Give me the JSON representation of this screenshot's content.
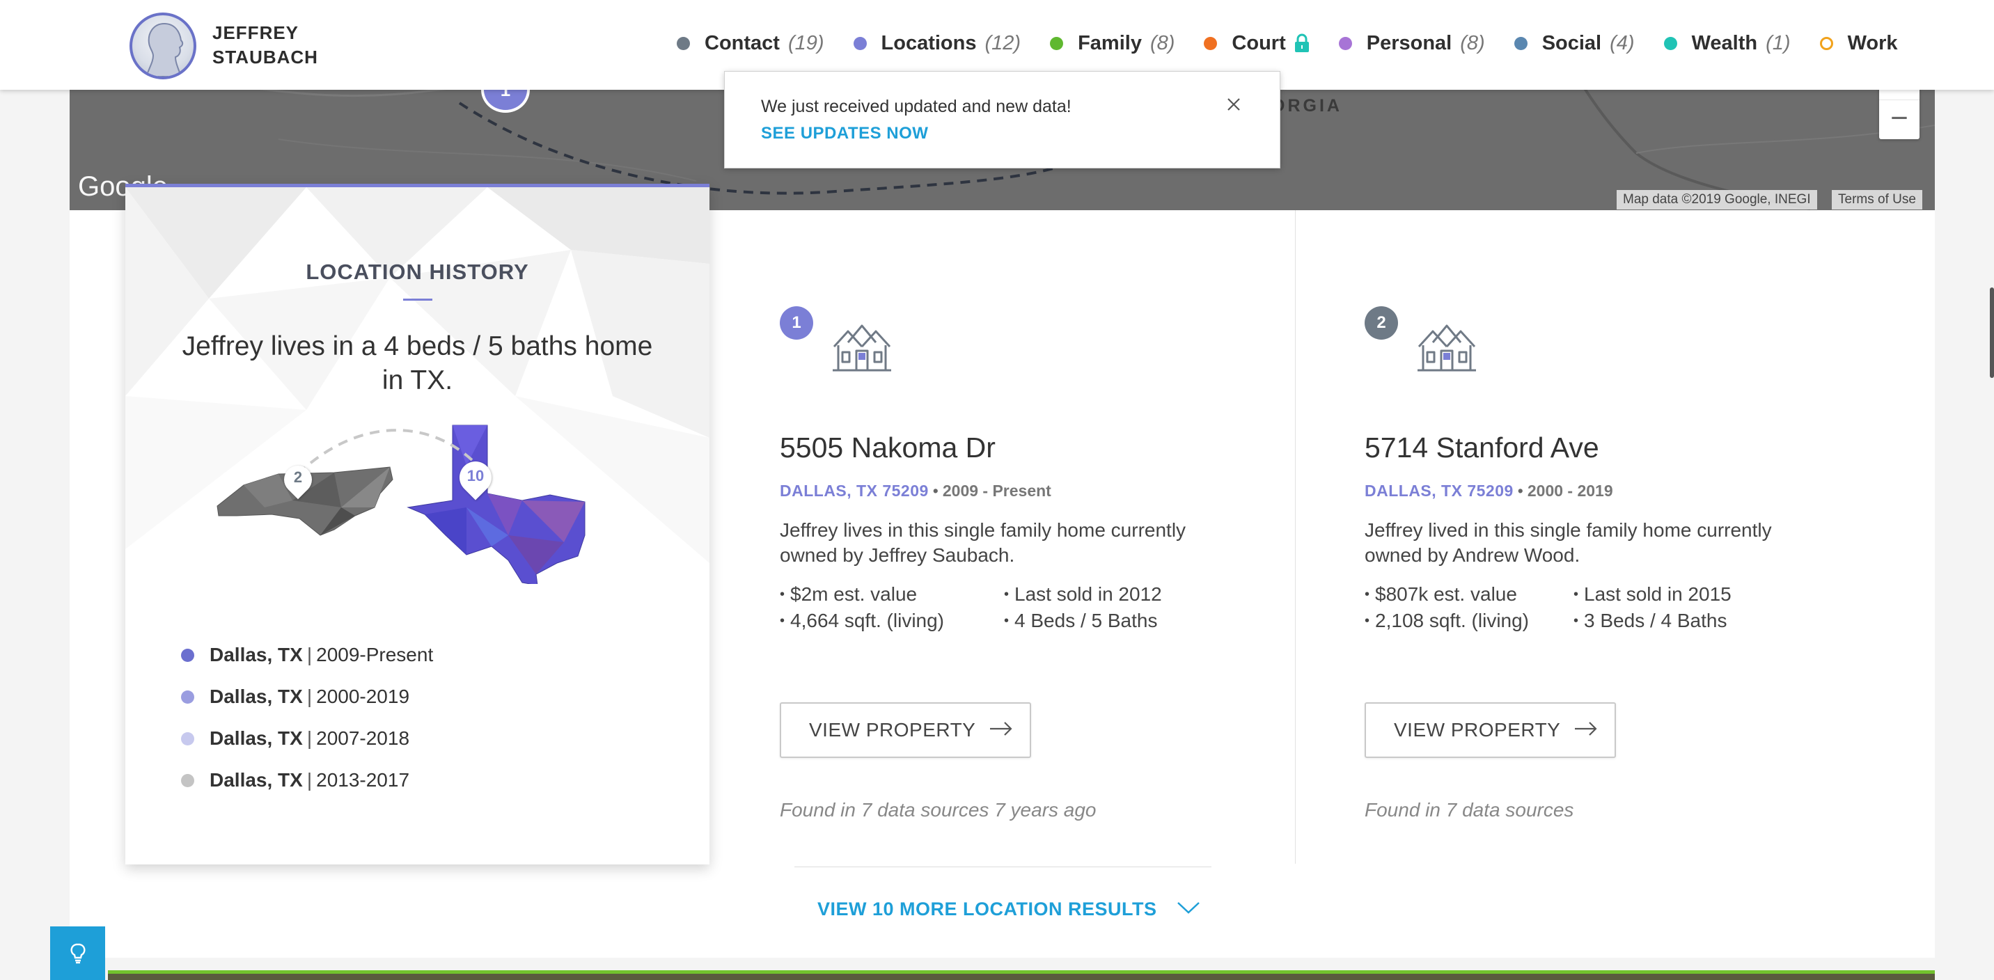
{
  "header": {
    "name_line1": "JEFFREY",
    "name_line2": "STAUBACH",
    "nav": [
      {
        "label": "Contact",
        "count": "(19)",
        "color": "#6e7a86"
      },
      {
        "label": "Locations",
        "count": "(12)",
        "color": "#7b7fd6"
      },
      {
        "label": "Family",
        "count": "(8)",
        "color": "#5fb82f"
      },
      {
        "label": "Court",
        "count": "",
        "color": "#f07021",
        "icon": "lock-icon"
      },
      {
        "label": "Personal",
        "count": "(8)",
        "color": "#a774d6"
      },
      {
        "label": "Social",
        "count": "(4)",
        "color": "#5a87b0"
      },
      {
        "label": "Wealth",
        "count": "(1)",
        "color": "#20c3b5"
      },
      {
        "label": "Work",
        "count": "",
        "color": "#f1a21c",
        "hollow": true
      }
    ]
  },
  "map": {
    "region_label": "ORGIA",
    "logo": "Google",
    "attribution": "Map data ©2019 Google, INEGI",
    "terms": "Terms of Use",
    "zoom_in": "+",
    "zoom_out": "−",
    "pin_number": "1"
  },
  "toast": {
    "message": "We just received updated and new data!",
    "link": "SEE UPDATES NOW"
  },
  "history": {
    "title": "LOCATION HISTORY",
    "summary": "Jeffrey lives in a 4 beds / 5 baths home in TX.",
    "state_pins": [
      "2",
      "10"
    ],
    "locations": [
      {
        "city": "Dallas, TX",
        "years": "2009-Present",
        "color": "#6b6fcf"
      },
      {
        "city": "Dallas, TX",
        "years": "2000-2019",
        "color": "#9a9de0"
      },
      {
        "city": "Dallas, TX",
        "years": "2007-2018",
        "color": "#c7c9ee"
      },
      {
        "city": "Dallas, TX",
        "years": "2013-2017",
        "color": "#c4c4c4"
      }
    ]
  },
  "properties": [
    {
      "number": "1",
      "number_color": "#7b7fd6",
      "address": "5505 Nakoma Dr",
      "city": "DALLAS, TX 75209",
      "years": "2009 - Present",
      "description": "Jeffrey lives in this single family home currently owned by Jeffrey Saubach.",
      "facts": [
        "$2m est. value",
        "Last sold in 2012",
        "4,664 sqft. (living)",
        "4 Beds / 5 Baths"
      ],
      "button": "VIEW PROPERTY",
      "found": "Found in 7 data sources 7 years ago"
    },
    {
      "number": "2",
      "number_color": "#6e7a86",
      "address": "5714 Stanford Ave",
      "city": "DALLAS, TX 75209",
      "years": "2000 - 2019",
      "description": "Jeffrey lived in this single family home currently owned by Andrew Wood.",
      "facts": [
        "$807k est. value",
        "Last sold in 2015",
        "2,108 sqft. (living)",
        "3 Beds / 4 Baths"
      ],
      "button": "VIEW PROPERTY",
      "found": "Found in 7 data sources"
    }
  ],
  "more": {
    "label": "VIEW 10 MORE LOCATION RESULTS"
  }
}
